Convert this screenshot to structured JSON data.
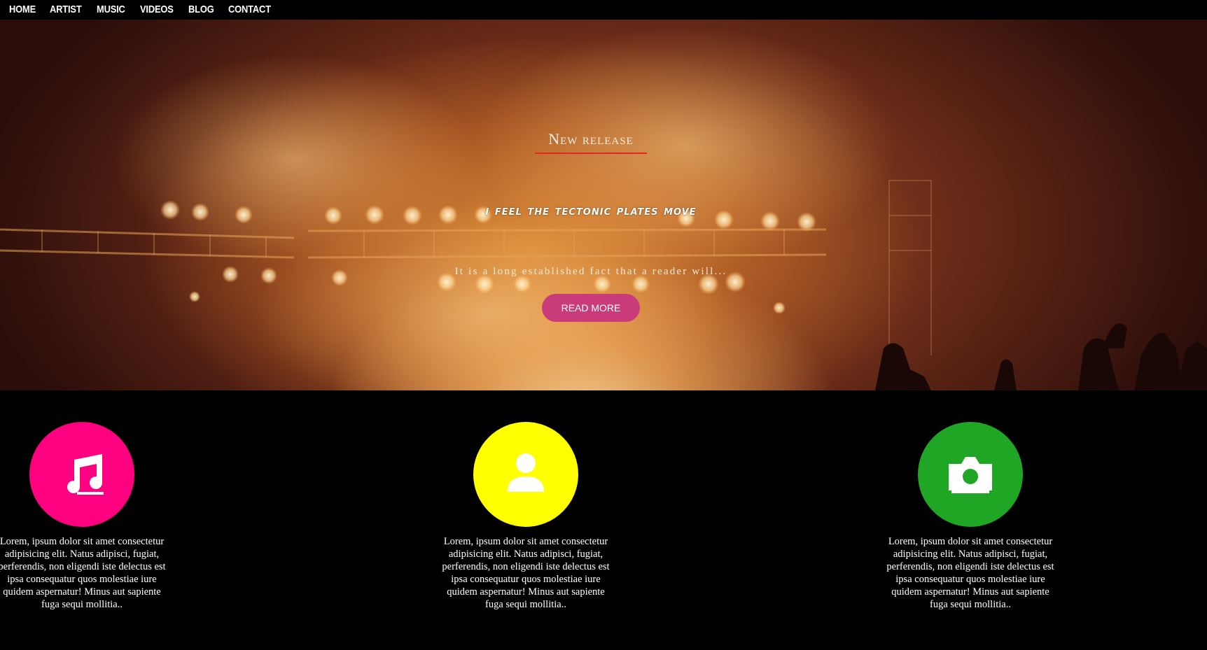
{
  "nav": {
    "items": [
      {
        "label": "HOME"
      },
      {
        "label": "ARTIST"
      },
      {
        "label": "MUSIC"
      },
      {
        "label": "VIDEOS"
      },
      {
        "label": "BLOG"
      },
      {
        "label": "CONTACT"
      }
    ]
  },
  "hero": {
    "subtitle": "New release",
    "headline": "I feel the tectonic plates move",
    "teaser": "It is a long established fact that a reader will...",
    "button_label": "READ MORE",
    "accent_color": "#e0281e",
    "button_color": "#c93b79"
  },
  "features": [
    {
      "icon": "music-note-icon",
      "color": "#ff0080",
      "text": "Lorem, ipsum dolor sit amet consectetur adipisicing elit. Natus adipisci, fugiat, perferendis, non eligendi iste delectus est ipsa consequatur quos molestiae iure quidem aspernatur! Minus aut sapiente fuga sequi mollitia.."
    },
    {
      "icon": "user-icon",
      "color": "#ffff00",
      "text": "Lorem, ipsum dolor sit amet consectetur adipisicing elit. Natus adipisci, fugiat, perferendis, non eligendi iste delectus est ipsa consequatur quos molestiae iure quidem aspernatur! Minus aut sapiente fuga sequi mollitia.."
    },
    {
      "icon": "camera-icon",
      "color": "#1fa624",
      "text": "Lorem, ipsum dolor sit amet consectetur adipisicing elit. Natus adipisci, fugiat, perferendis, non eligendi iste delectus est ipsa consequatur quos molestiae iure quidem aspernatur! Minus aut sapiente fuga sequi mollitia.."
    }
  ]
}
